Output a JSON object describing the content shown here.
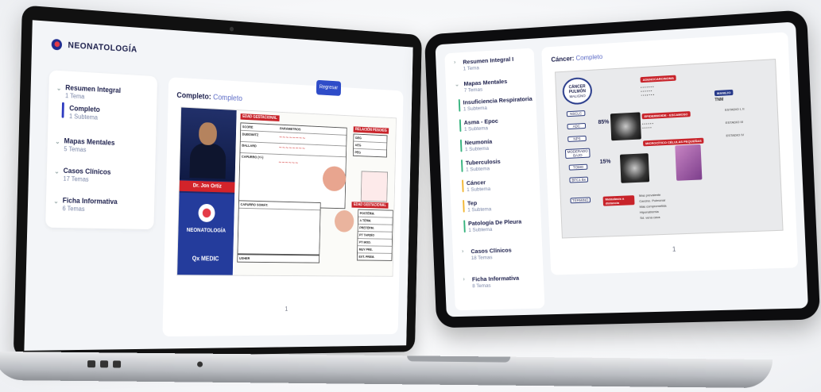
{
  "laptop": {
    "app_title": "NEONATOLOGÍA",
    "back_button": "Regresar",
    "content_heading": "Completo:",
    "content_sub": "Completo",
    "page_number": "1",
    "sidebar": [
      {
        "title": "Resumen Integral",
        "subtitle": "1 Tema"
      },
      {
        "title": "Completo",
        "subtitle": "1 Subtema"
      },
      {
        "title": "Mapas Mentales",
        "subtitle": "5 Temas"
      },
      {
        "title": "Casos Clínicos",
        "subtitle": "17 Temas"
      },
      {
        "title": "Ficha Informativa",
        "subtitle": "6 Temas"
      }
    ],
    "video": {
      "presenter": "Dr. Jon Ortiz",
      "brand": "NEONATOLOGÍA",
      "logo_text": "Qx MEDIC"
    },
    "sheet": {
      "tag1": "EDAD GESTACIONAL",
      "tag2": "RELACIÓN PESO/EG",
      "tag3": "EDAD GESTACIONAL",
      "col1": "SCORE",
      "col2": "PARÁMETROS",
      "scores": [
        "DUBOWITZ",
        "BALLARD",
        "CAPURRO (+/-)"
      ],
      "capurro": "CAPURRO SOMÁT.",
      "usher": "USHER",
      "right_labels": [
        "GEG",
        "AEG",
        "PEG"
      ],
      "bottom_labels": [
        "POSTÉRM.",
        "A TÉRM.",
        "PRETÉRM.",
        "PT TARDÍO",
        "PT MOD.",
        "MUY PRE.",
        "EXT. PREM."
      ]
    }
  },
  "tablet": {
    "content_heading": "Cáncer:",
    "content_sub": "Completo",
    "page_number": "1",
    "sidebar": [
      {
        "title": "Resumen Integral I",
        "subtitle": "1 Tema",
        "bar": ""
      },
      {
        "title": "Mapas Mentales",
        "subtitle": "7 Temas",
        "bar": ""
      },
      {
        "title": "Insuficiencia Respiratoria",
        "subtitle": "1 Subtema",
        "bar": "#36b37e"
      },
      {
        "title": "Asma - Epoc",
        "subtitle": "1 Subtema",
        "bar": "#36b37e"
      },
      {
        "title": "Neumonía",
        "subtitle": "1 Subtema",
        "bar": "#36b37e"
      },
      {
        "title": "Tuberculosis",
        "subtitle": "1 Subtema",
        "bar": "#36b37e"
      },
      {
        "title": "Cáncer",
        "subtitle": "1 Subtema",
        "bar": "#f2b632"
      },
      {
        "title": "Tep",
        "subtitle": "1 Subtema",
        "bar": "#f2b632"
      },
      {
        "title": "Patología De Pleura",
        "subtitle": "1 Subtema",
        "bar": "#36b37e"
      },
      {
        "title": "Casos Clínicos",
        "subtitle": "18 Temas",
        "bar": ""
      },
      {
        "title": "Ficha Informativa",
        "subtitle": "8 Temas",
        "bar": ""
      }
    ],
    "mindmap": {
      "center": "CÁNCER PULMÓN",
      "center_sub": "MALIGNO",
      "pct1": "85%",
      "pct2": "15%",
      "red1": "ADENOCARCINOMA",
      "red2": "EPIDERMOIDE - ESCAMOSO",
      "red3": "MICROCÍTICO CÉLULAS PEQUEÑAS",
      "red4": "Metástasis a distancia",
      "navy1": "MANEJO",
      "tnm": "TNM",
      "nodes": [
        "NSCLC",
        "ADC",
        "NPS",
        "MODERADO BAJO",
        "TOMO",
        "BFC1 Bx",
        "TÉRMINO"
      ],
      "right_lines": [
        "ESTADIO I, II",
        "ESTADIO III",
        "ESTADIO IV"
      ],
      "bottom_lines": [
        "Mas prevalente",
        "Carcino. Pulmonar",
        "Más comprometida",
        "Hiponatremia",
        "Sd. vena cava"
      ]
    }
  }
}
